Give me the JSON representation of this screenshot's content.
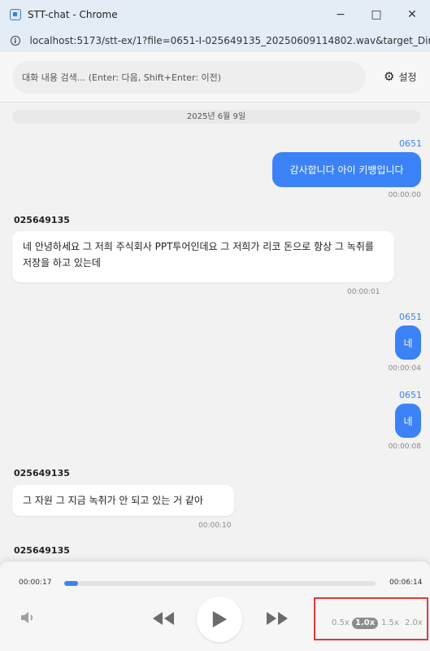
{
  "window": {
    "title": "STT-chat - Chrome",
    "minimize": "−",
    "maximize": "□",
    "close": "✕"
  },
  "address": {
    "url": "localhost:5173/stt-ex/1?file=0651-I-025649135_20250609114802.wav&target_Dir=..."
  },
  "search": {
    "placeholder": "대화 내용 검색... (Enter: 다음, Shift+Enter: 이전)"
  },
  "settings": {
    "label": "설정"
  },
  "chat": {
    "date": "2025년 6월 9일",
    "messages": [
      {
        "speaker": "0651",
        "text": "감사합니다 아이 키뱅입니다",
        "time": "00:00:00"
      },
      {
        "speaker": "025649135",
        "text": "네 안녕하세요 그 저희 주식회사 PPT투어인데요 그 저희가 리코 돈으로 항상 그 녹취를 저장을 하고 있는데",
        "time": "00:00:01"
      },
      {
        "speaker": "0651",
        "text": "네",
        "time": "00:00:04"
      },
      {
        "speaker": "0651",
        "text": "네",
        "time": "00:00:08"
      },
      {
        "speaker": "025649135",
        "text": "그 자원 그 지금 녹취가 안 되고 있는 거 같아",
        "time": "00:00:10"
      },
      {
        "speaker": "025649135"
      }
    ]
  },
  "player": {
    "current_time": "00:00:17",
    "total_time": "00:06:14",
    "progress": 0.045,
    "speeds": [
      "0.5x",
      "1.0x",
      "1.5x",
      "2.0x"
    ],
    "active_speed": "1.0x"
  },
  "colors": {
    "accent": "#3b82f6",
    "highlight_border": "#e53935"
  },
  "icons": [
    "info-icon",
    "gear-icon",
    "volume-icon",
    "rewind-icon",
    "play-icon",
    "fast-forward-icon"
  ]
}
